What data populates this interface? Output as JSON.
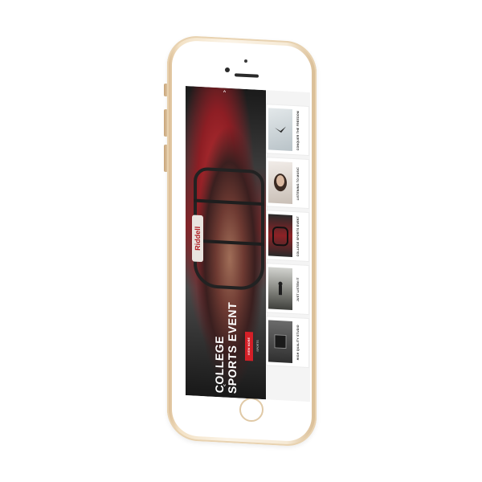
{
  "app": {
    "hero": {
      "title": "COLLEGE\nSPORTS EVENT",
      "tag_label": "VIEW MORE",
      "meta_text": "SPORTS",
      "badge_text": "Riddell",
      "arrow_up": "˄",
      "arrow_down": "˅"
    },
    "cards": [
      {
        "title": "CONQUER THE FREEDOM",
        "thumb_icon": "bird-icon",
        "thumb_color": "#cfd6da"
      },
      {
        "title": "LISTENING TO MUSIC",
        "thumb_icon": "headphones-icon",
        "thumb_color": "#e6e1dd"
      },
      {
        "title": "COLLEGE SPORTS EVENT",
        "thumb_icon": "helmet-icon",
        "thumb_color": "#5a2a2c"
      },
      {
        "title": "JUST LISTEN IT",
        "thumb_icon": "field-icon",
        "thumb_color": "#8a8c86"
      },
      {
        "title": "HIGH QUALITY STUDIO",
        "thumb_icon": "studio-icon",
        "thumb_color": "#4b4b4b"
      }
    ]
  },
  "colors": {
    "accent": "#d51f27",
    "phone_gold": "#f3e2c6"
  }
}
